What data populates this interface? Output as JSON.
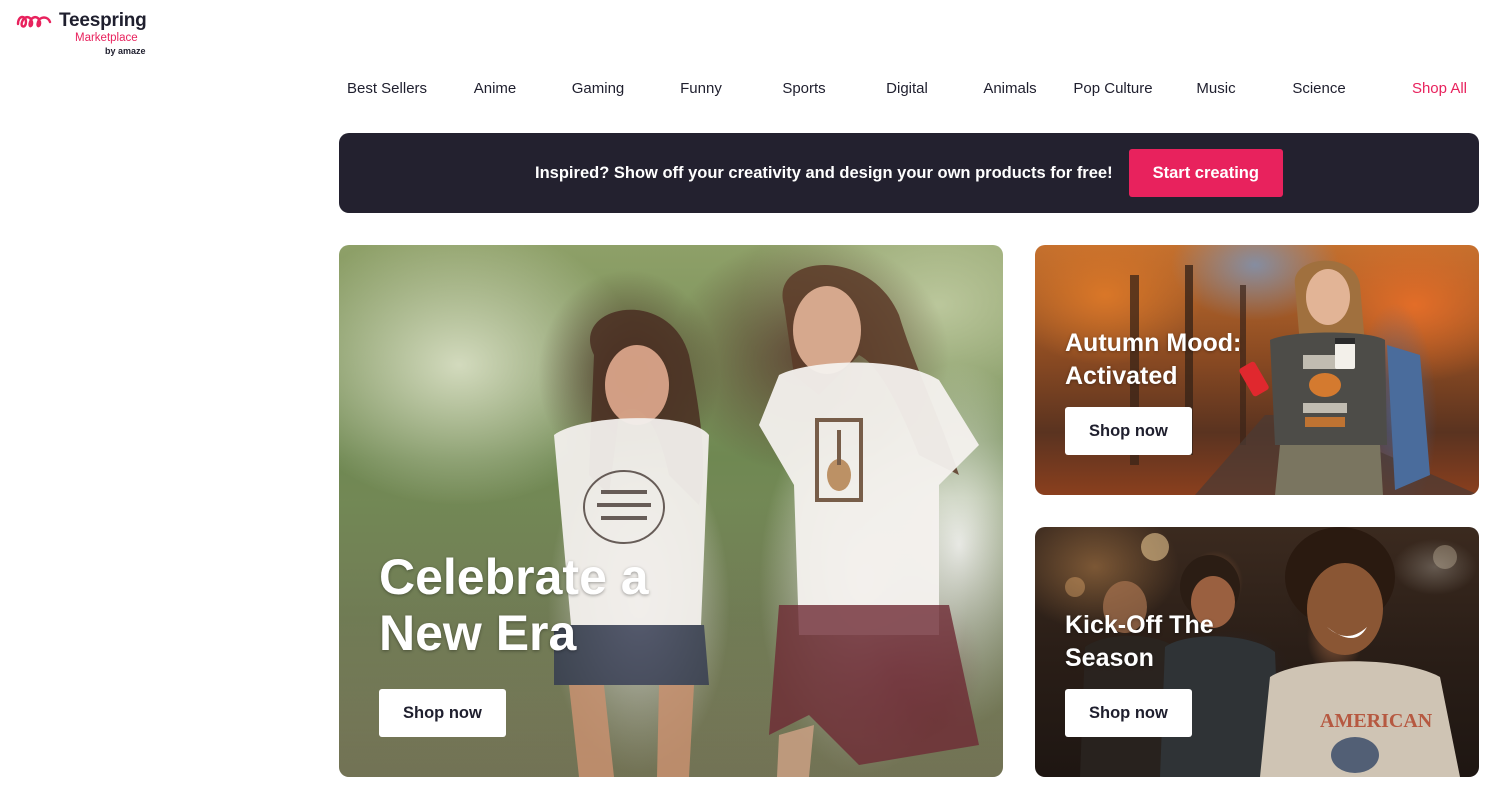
{
  "logo": {
    "name": "Teespring",
    "subtitle": "Marketplace",
    "byline": "by amaze",
    "brand_color": "#e8225d"
  },
  "nav": {
    "items": [
      {
        "label": "Best Sellers"
      },
      {
        "label": "Anime"
      },
      {
        "label": "Gaming"
      },
      {
        "label": "Funny"
      },
      {
        "label": "Sports"
      },
      {
        "label": "Digital"
      },
      {
        "label": "Animals"
      },
      {
        "label": "Pop Culture"
      },
      {
        "label": "Music"
      },
      {
        "label": "Science"
      },
      {
        "label": "Shop All"
      }
    ]
  },
  "banner": {
    "text": "Inspired? Show off your creativity and design your own products for free!",
    "button_label": "Start creating",
    "background": "#23212f"
  },
  "cards": {
    "main": {
      "title_line1": "Celebrate a",
      "title_line2": "New Era",
      "button_label": "Shop now"
    },
    "autumn": {
      "title_line1": "Autumn Mood:",
      "title_line2": "Activated",
      "button_label": "Shop now"
    },
    "kickoff": {
      "title_line1": "Kick-Off The",
      "title_line2": "Season",
      "button_label": "Shop now"
    }
  }
}
